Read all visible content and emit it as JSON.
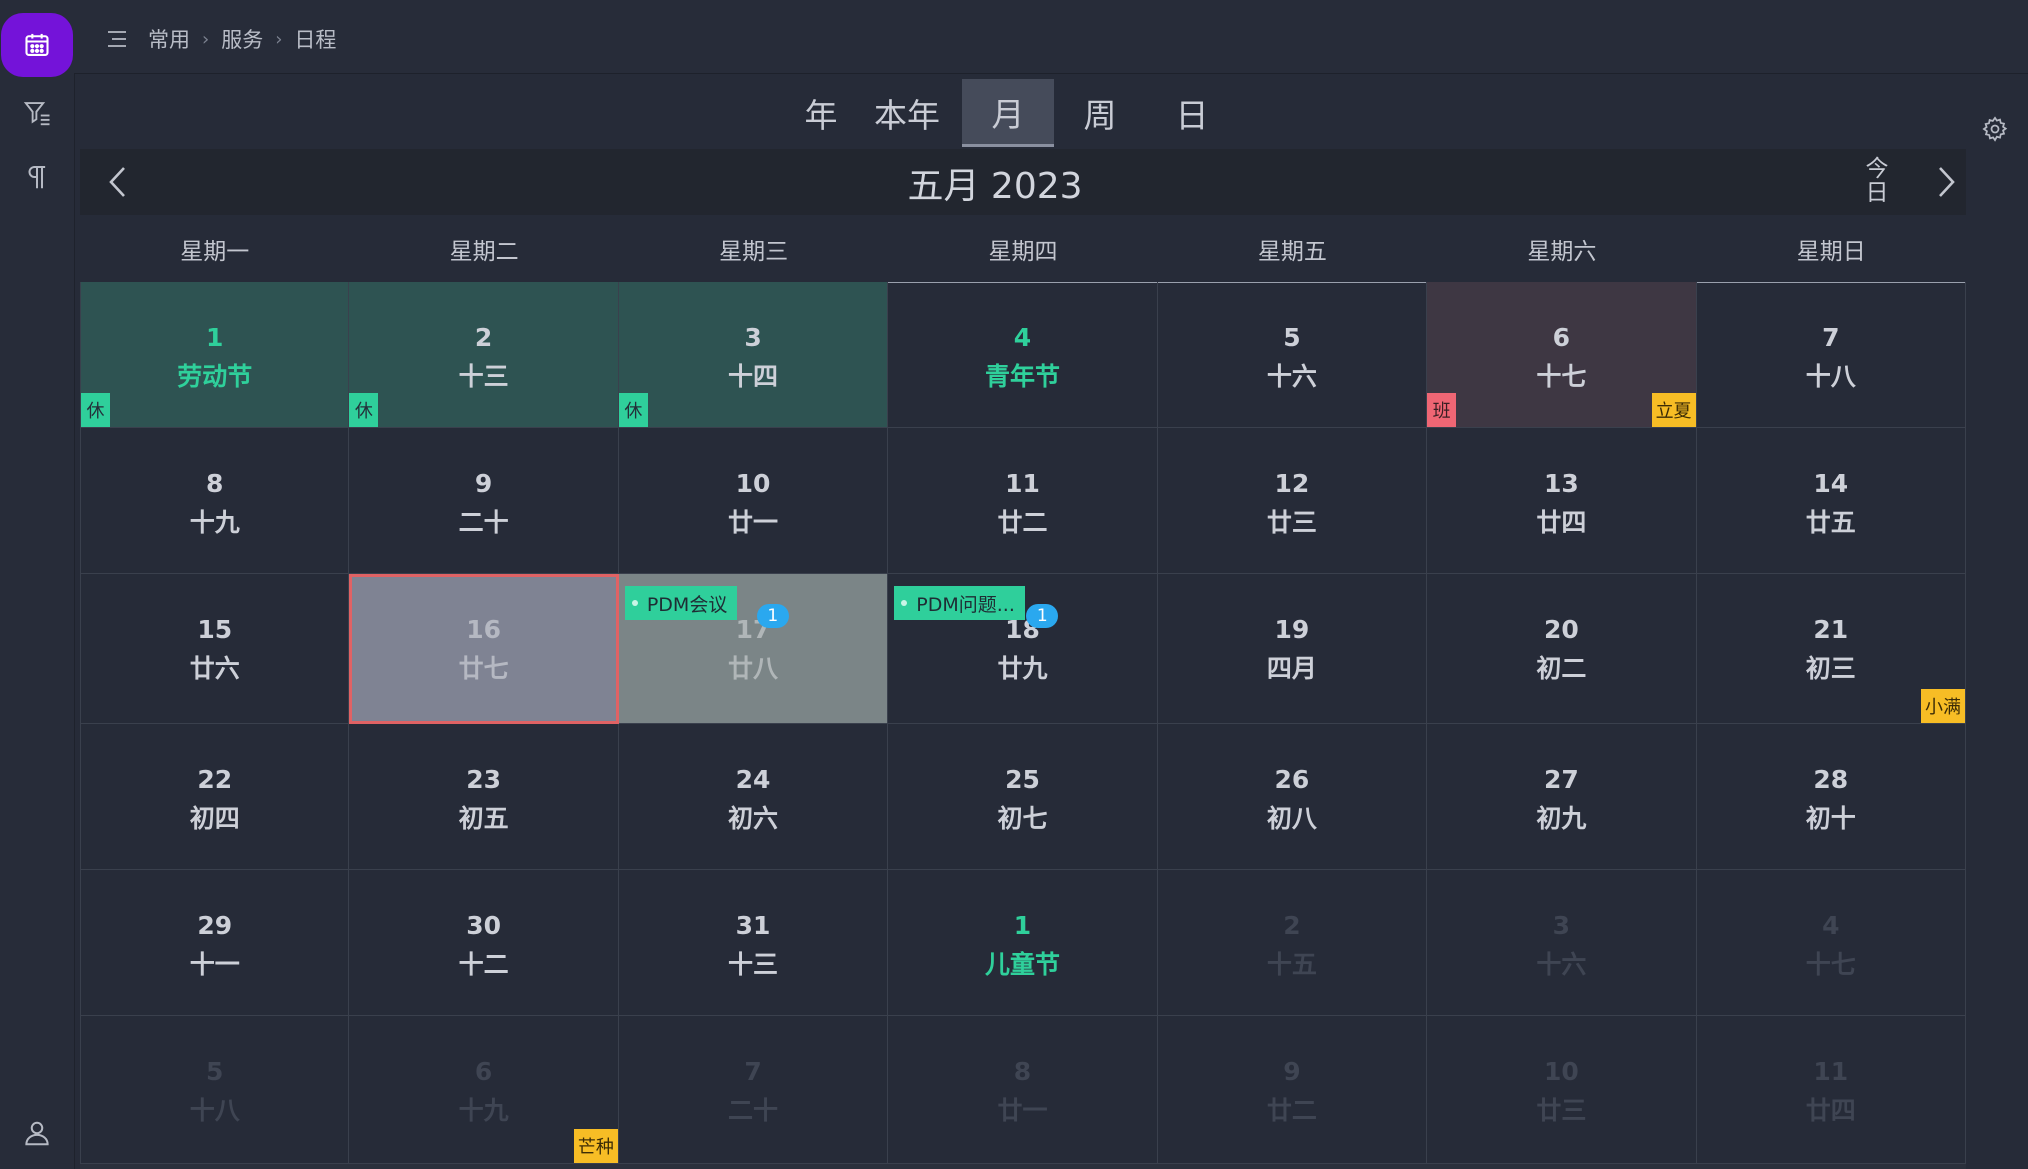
{
  "breadcrumb": [
    "常用",
    "服务",
    "日程"
  ],
  "view_tabs": [
    {
      "label": "年",
      "active": false
    },
    {
      "label": "本年",
      "active": false
    },
    {
      "label": "月",
      "active": true
    },
    {
      "label": "周",
      "active": false
    },
    {
      "label": "日",
      "active": false
    }
  ],
  "calendar": {
    "title": "五月 2023",
    "today_label": "今\n日",
    "weekdays": [
      "星期一",
      "星期二",
      "星期三",
      "星期四",
      "星期五",
      "星期六",
      "星期日"
    ],
    "days": [
      {
        "day": "1",
        "lunar": "劳动节",
        "type": "holiday",
        "festival": true,
        "badge": "休",
        "badge_kind": "rest"
      },
      {
        "day": "2",
        "lunar": "十三",
        "type": "holiday",
        "badge": "休",
        "badge_kind": "rest"
      },
      {
        "day": "3",
        "lunar": "十四",
        "type": "holiday",
        "badge": "休",
        "badge_kind": "rest"
      },
      {
        "day": "4",
        "lunar": "青年节",
        "festival": true
      },
      {
        "day": "5",
        "lunar": "十六"
      },
      {
        "day": "6",
        "lunar": "十七",
        "type": "workday",
        "badge": "班",
        "badge_kind": "work",
        "term": "立夏"
      },
      {
        "day": "7",
        "lunar": "十八"
      },
      {
        "day": "8",
        "lunar": "十九"
      },
      {
        "day": "9",
        "lunar": "二十"
      },
      {
        "day": "10",
        "lunar": "廿一"
      },
      {
        "day": "11",
        "lunar": "廿二"
      },
      {
        "day": "12",
        "lunar": "廿三"
      },
      {
        "day": "13",
        "lunar": "廿四"
      },
      {
        "day": "14",
        "lunar": "廿五"
      },
      {
        "day": "15",
        "lunar": "廿六"
      },
      {
        "day": "16",
        "lunar": "廿七",
        "type": "today"
      },
      {
        "day": "17",
        "lunar": "廿八",
        "type": "event-day",
        "event": "PDM会议",
        "count": "1"
      },
      {
        "day": "18",
        "lunar": "廿九",
        "event": "PDM问题...",
        "count": "1"
      },
      {
        "day": "19",
        "lunar": "四月"
      },
      {
        "day": "20",
        "lunar": "初二"
      },
      {
        "day": "21",
        "lunar": "初三",
        "term": "小满"
      },
      {
        "day": "22",
        "lunar": "初四"
      },
      {
        "day": "23",
        "lunar": "初五"
      },
      {
        "day": "24",
        "lunar": "初六"
      },
      {
        "day": "25",
        "lunar": "初七"
      },
      {
        "day": "26",
        "lunar": "初八"
      },
      {
        "day": "27",
        "lunar": "初九"
      },
      {
        "day": "28",
        "lunar": "初十"
      },
      {
        "day": "29",
        "lunar": "十一"
      },
      {
        "day": "30",
        "lunar": "十二"
      },
      {
        "day": "31",
        "lunar": "十三"
      },
      {
        "day": "1",
        "lunar": "儿童节",
        "festival": true
      },
      {
        "day": "2",
        "lunar": "十五",
        "other": true
      },
      {
        "day": "3",
        "lunar": "十六",
        "other": true
      },
      {
        "day": "4",
        "lunar": "十七",
        "other": true
      },
      {
        "day": "5",
        "lunar": "十八",
        "other": true
      },
      {
        "day": "6",
        "lunar": "十九",
        "other": true,
        "term": "芒种"
      },
      {
        "day": "7",
        "lunar": "二十",
        "other": true
      },
      {
        "day": "8",
        "lunar": "廿一",
        "other": true
      },
      {
        "day": "9",
        "lunar": "廿二",
        "other": true
      },
      {
        "day": "10",
        "lunar": "廿三",
        "other": true
      },
      {
        "day": "11",
        "lunar": "廿四",
        "other": true
      }
    ]
  },
  "sidebar": {
    "items": [
      {
        "name": "calendar-icon"
      },
      {
        "name": "filter-icon"
      },
      {
        "name": "paragraph-icon"
      },
      {
        "name": "user-icon"
      }
    ]
  },
  "colors": {
    "accent": "#7413d9",
    "holiday_bg": "#2e5352",
    "festival_text": "#2fd09b",
    "rest_badge": "#2fcf9b",
    "work_badge": "#ef6674",
    "term_badge": "#f7bd25",
    "today_border": "#e06264",
    "count_badge": "#2aa8ef"
  }
}
